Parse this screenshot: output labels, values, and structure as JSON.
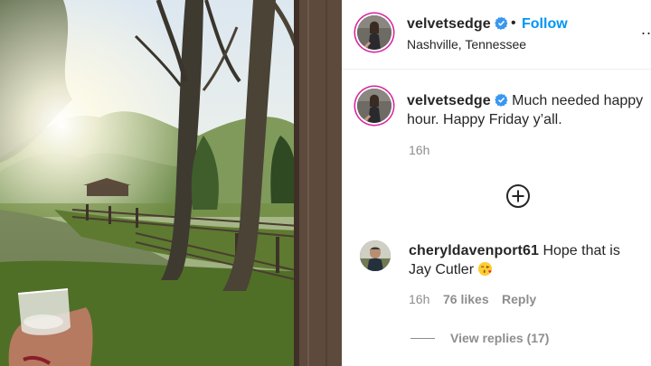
{
  "post": {
    "username": "velvetsedge",
    "verified": true,
    "follow_label": "Follow",
    "separator": "•",
    "location": "Nashville, Tennessee",
    "more_label": "..."
  },
  "caption": {
    "username": "velvetsedge",
    "text": "Much needed happy hour. Happy Friday y’all.",
    "time": "16h"
  },
  "comment": {
    "username": "cheryldavenport61",
    "text": "Hope that is Jay Cutler",
    "emoji": "face-blowing-kiss",
    "time": "16h",
    "likes": "76 likes",
    "reply_label": "Reply"
  },
  "view_replies": "View replies (17)",
  "icons": {
    "verified": "verified-badge-icon",
    "add_comment": "plus-circle-icon",
    "more": "more-options-icon"
  },
  "colors": {
    "accent": "#0095f6",
    "secondary_text": "#8e8e8e",
    "text": "#262626",
    "story_ring": "#d6249f"
  }
}
